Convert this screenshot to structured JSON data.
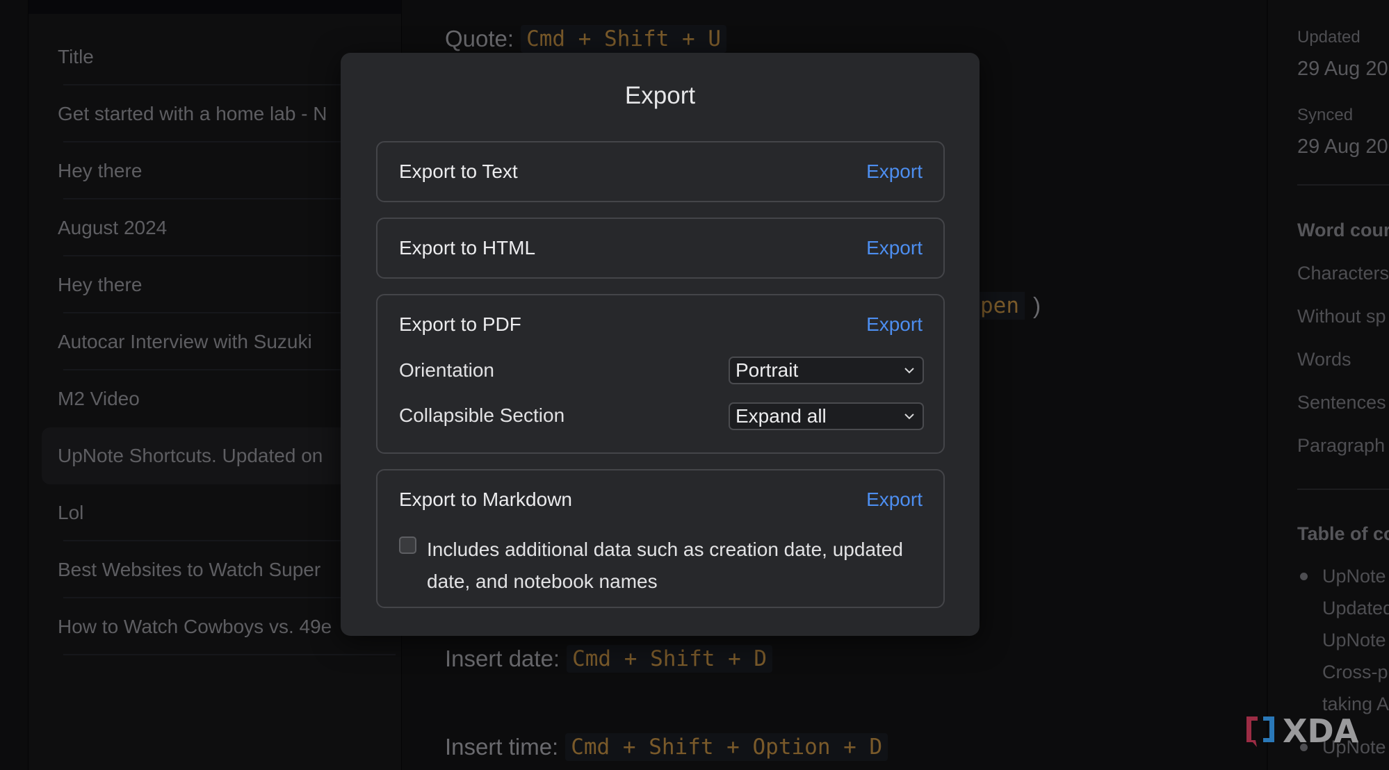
{
  "note_list": {
    "items": [
      {
        "title": "Title"
      },
      {
        "title": "Get started with a home lab - N"
      },
      {
        "title": "Hey there"
      },
      {
        "title": "August 2024"
      },
      {
        "title": "Hey there"
      },
      {
        "title": "Autocar Interview with Suzuki"
      },
      {
        "title": "M2 Video"
      },
      {
        "title": "UpNote Shortcuts. Updated on",
        "selected": true
      },
      {
        "title": "Lol"
      },
      {
        "title": "Best Websites to Watch Super"
      },
      {
        "title": "How to Watch Cowboys vs. 49e"
      }
    ]
  },
  "editor": {
    "lines": [
      {
        "label": "Quote:",
        "shortcut": "Cmd + Shift + U"
      },
      {
        "label": "Insert date:",
        "shortcut": "Cmd + Shift + D"
      },
      {
        "label": "Insert time:",
        "shortcut": "Cmd + Shift + Option + D"
      }
    ],
    "fragment": {
      "shortcut_tail": "pen",
      "paren": ")"
    }
  },
  "info_panel": {
    "updated_label": "Updated",
    "updated_value": "29 Aug 20",
    "synced_label": "Synced",
    "synced_value": "29 Aug 20",
    "word_count_header": "Word cour",
    "stats": [
      "Characters",
      "Without sp",
      "Words",
      "Sentences",
      "Paragraph"
    ],
    "toc_header": "Table of co",
    "toc_lines": [
      "UpNote",
      "Updated",
      "UpNote",
      "Cross-p",
      "taking A",
      "UpNote"
    ]
  },
  "modal": {
    "title": "Export",
    "sections": {
      "text": {
        "title": "Export to Text",
        "action": "Export"
      },
      "html": {
        "title": "Export to HTML",
        "action": "Export"
      },
      "pdf": {
        "title": "Export to PDF",
        "action": "Export",
        "orientation_label": "Orientation",
        "orientation_value": "Portrait",
        "collapsible_label": "Collapsible Section",
        "collapsible_value": "Expand all"
      },
      "markdown": {
        "title": "Export to Markdown",
        "action": "Export",
        "checkbox_checked": false,
        "checkbox_label": "Includes additional data such as creation date, updated date, and notebook names"
      }
    }
  },
  "watermark": {
    "text": "XDA"
  },
  "colors": {
    "accent_link": "#4d8ef0",
    "modal_bg": "#27282b",
    "shortcut_text": "#7a5a2a"
  }
}
